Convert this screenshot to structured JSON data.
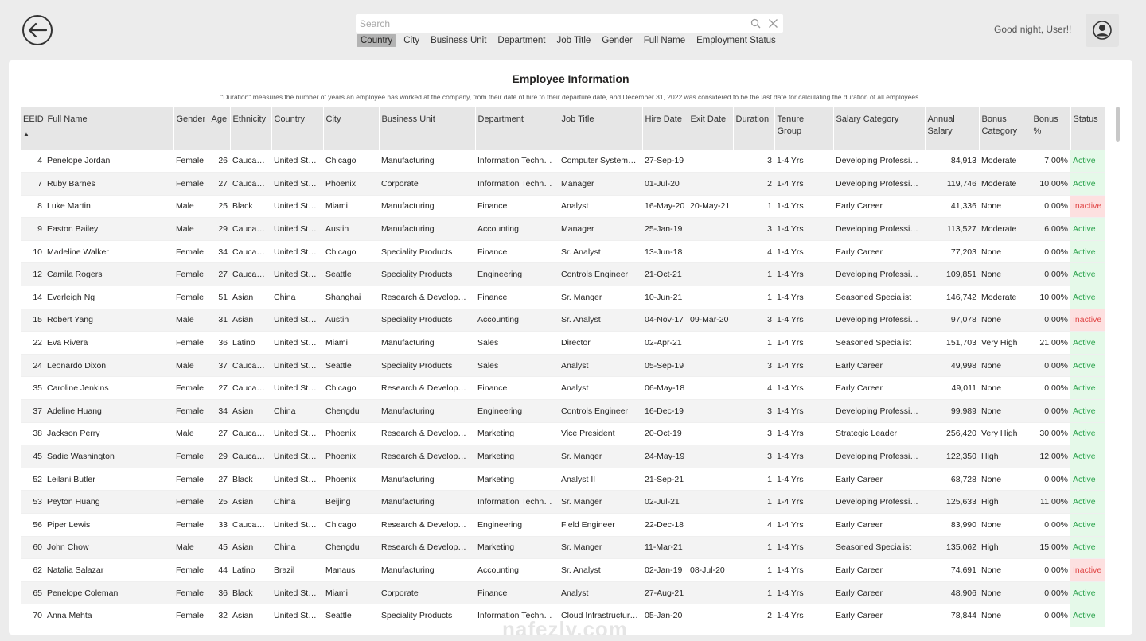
{
  "header": {
    "search_placeholder": "Search",
    "filters": [
      "Country",
      "City",
      "Business Unit",
      "Department",
      "Job Title",
      "Gender",
      "Full Name",
      "Employment Status"
    ],
    "active_filter": "Country",
    "greeting": "Good night, User!!"
  },
  "card": {
    "title": "Employee Information",
    "note": "\"Duration\" measures the number of years an employee has worked at the company, from their date of hire to their departure date, and December 31, 2022 was considered to be the last date for calculating the duration of all employees."
  },
  "table": {
    "columns": [
      "EEID",
      "Full Name",
      "Gender",
      "Age",
      "Ethnicity",
      "Country",
      "City",
      "Business Unit",
      "Department",
      "Job Title",
      "Hire Date",
      "Exit Date",
      "Duration",
      "Tenure Group",
      "Salary Category",
      "Annual Salary",
      "Bonus Category",
      "Bonus %",
      "Status"
    ],
    "sort_indicator": "▲",
    "rows": [
      [
        "4",
        "Penelope Jordan",
        "Female",
        "26",
        "Caucasian",
        "United Stat...",
        "Chicago",
        "Manufacturing",
        "Information Technol...",
        "Computer Systems ...",
        "27-Sep-19",
        "",
        "3",
        "1-4 Yrs",
        "Developing Professional",
        "84,913",
        "Moderate",
        "7.00%",
        "Active"
      ],
      [
        "7",
        "Ruby Barnes",
        "Female",
        "27",
        "Caucasian",
        "United Stat...",
        "Phoenix",
        "Corporate",
        "Information Technol...",
        "Manager",
        "01-Jul-20",
        "",
        "2",
        "1-4 Yrs",
        "Developing Professional",
        "119,746",
        "Moderate",
        "10.00%",
        "Active"
      ],
      [
        "8",
        "Luke Martin",
        "Male",
        "25",
        "Black",
        "United Stat...",
        "Miami",
        "Manufacturing",
        "Finance",
        "Analyst",
        "16-May-20",
        "20-May-21",
        "1",
        "1-4 Yrs",
        "Early Career",
        "41,336",
        "None",
        "0.00%",
        "Inactive"
      ],
      [
        "9",
        "Easton Bailey",
        "Male",
        "29",
        "Caucasian",
        "United Stat...",
        "Austin",
        "Manufacturing",
        "Accounting",
        "Manager",
        "25-Jan-19",
        "",
        "3",
        "1-4 Yrs",
        "Developing Professional",
        "113,527",
        "Moderate",
        "6.00%",
        "Active"
      ],
      [
        "10",
        "Madeline Walker",
        "Female",
        "34",
        "Caucasian",
        "United Stat...",
        "Chicago",
        "Speciality Products",
        "Finance",
        "Sr. Analyst",
        "13-Jun-18",
        "",
        "4",
        "1-4 Yrs",
        "Early Career",
        "77,203",
        "None",
        "0.00%",
        "Active"
      ],
      [
        "12",
        "Camila Rogers",
        "Female",
        "27",
        "Caucasian",
        "United Stat...",
        "Seattle",
        "Speciality Products",
        "Engineering",
        "Controls Engineer",
        "21-Oct-21",
        "",
        "1",
        "1-4 Yrs",
        "Developing Professional",
        "109,851",
        "None",
        "0.00%",
        "Active"
      ],
      [
        "14",
        "Everleigh Ng",
        "Female",
        "51",
        "Asian",
        "China",
        "Shanghai",
        "Research & Development",
        "Finance",
        "Sr. Manger",
        "10-Jun-21",
        "",
        "1",
        "1-4 Yrs",
        "Seasoned Specialist",
        "146,742",
        "Moderate",
        "10.00%",
        "Active"
      ],
      [
        "15",
        "Robert Yang",
        "Male",
        "31",
        "Asian",
        "United Stat...",
        "Austin",
        "Speciality Products",
        "Accounting",
        "Sr. Analyst",
        "04-Nov-17",
        "09-Mar-20",
        "3",
        "1-4 Yrs",
        "Developing Professional",
        "97,078",
        "None",
        "0.00%",
        "Inactive"
      ],
      [
        "22",
        "Eva Rivera",
        "Female",
        "36",
        "Latino",
        "United Stat...",
        "Miami",
        "Manufacturing",
        "Sales",
        "Director",
        "02-Apr-21",
        "",
        "1",
        "1-4 Yrs",
        "Seasoned Specialist",
        "151,703",
        "Very High",
        "21.00%",
        "Active"
      ],
      [
        "24",
        "Leonardo Dixon",
        "Male",
        "37",
        "Caucasian",
        "United Stat...",
        "Seattle",
        "Speciality Products",
        "Sales",
        "Analyst",
        "05-Sep-19",
        "",
        "3",
        "1-4 Yrs",
        "Early Career",
        "49,998",
        "None",
        "0.00%",
        "Active"
      ],
      [
        "35",
        "Caroline Jenkins",
        "Female",
        "27",
        "Caucasian",
        "United Stat...",
        "Chicago",
        "Research & Development",
        "Finance",
        "Analyst",
        "06-May-18",
        "",
        "4",
        "1-4 Yrs",
        "Early Career",
        "49,011",
        "None",
        "0.00%",
        "Active"
      ],
      [
        "37",
        "Adeline Huang",
        "Female",
        "34",
        "Asian",
        "China",
        "Chengdu",
        "Manufacturing",
        "Engineering",
        "Controls Engineer",
        "16-Dec-19",
        "",
        "3",
        "1-4 Yrs",
        "Developing Professional",
        "99,989",
        "None",
        "0.00%",
        "Active"
      ],
      [
        "38",
        "Jackson Perry",
        "Male",
        "27",
        "Caucasian",
        "United Stat...",
        "Phoenix",
        "Research & Development",
        "Marketing",
        "Vice President",
        "20-Oct-19",
        "",
        "3",
        "1-4 Yrs",
        "Strategic Leader",
        "256,420",
        "Very High",
        "30.00%",
        "Active"
      ],
      [
        "45",
        "Sadie Washington",
        "Female",
        "29",
        "Caucasian",
        "United Stat...",
        "Phoenix",
        "Research & Development",
        "Marketing",
        "Sr. Manger",
        "24-May-19",
        "",
        "3",
        "1-4 Yrs",
        "Developing Professional",
        "122,350",
        "High",
        "12.00%",
        "Active"
      ],
      [
        "52",
        "Leilani Butler",
        "Female",
        "27",
        "Black",
        "United Stat...",
        "Phoenix",
        "Manufacturing",
        "Marketing",
        "Analyst II",
        "21-Sep-21",
        "",
        "1",
        "1-4 Yrs",
        "Early Career",
        "68,728",
        "None",
        "0.00%",
        "Active"
      ],
      [
        "53",
        "Peyton Huang",
        "Female",
        "25",
        "Asian",
        "China",
        "Beijing",
        "Manufacturing",
        "Information Technol...",
        "Sr. Manger",
        "02-Jul-21",
        "",
        "1",
        "1-4 Yrs",
        "Developing Professional",
        "125,633",
        "High",
        "11.00%",
        "Active"
      ],
      [
        "56",
        "Piper Lewis",
        "Female",
        "33",
        "Caucasian",
        "United Stat...",
        "Chicago",
        "Research & Development",
        "Engineering",
        "Field Engineer",
        "22-Dec-18",
        "",
        "4",
        "1-4 Yrs",
        "Early Career",
        "83,990",
        "None",
        "0.00%",
        "Active"
      ],
      [
        "60",
        "John Chow",
        "Male",
        "45",
        "Asian",
        "China",
        "Chengdu",
        "Research & Development",
        "Marketing",
        "Sr. Manger",
        "11-Mar-21",
        "",
        "1",
        "1-4 Yrs",
        "Seasoned Specialist",
        "135,062",
        "High",
        "15.00%",
        "Active"
      ],
      [
        "62",
        "Natalia Salazar",
        "Female",
        "44",
        "Latino",
        "Brazil",
        "Manaus",
        "Manufacturing",
        "Accounting",
        "Sr. Analyst",
        "02-Jan-19",
        "08-Jul-20",
        "1",
        "1-4 Yrs",
        "Early Career",
        "74,691",
        "None",
        "0.00%",
        "Inactive"
      ],
      [
        "65",
        "Penelope Coleman",
        "Female",
        "36",
        "Black",
        "United Stat...",
        "Miami",
        "Corporate",
        "Finance",
        "Analyst",
        "27-Aug-21",
        "",
        "1",
        "1-4 Yrs",
        "Early Career",
        "48,906",
        "None",
        "0.00%",
        "Active"
      ],
      [
        "70",
        "Anna Mehta",
        "Female",
        "32",
        "Asian",
        "United Stat...",
        "Seattle",
        "Speciality Products",
        "Information Technol...",
        "Cloud Infrastructure...",
        "05-Jan-20",
        "",
        "2",
        "1-4 Yrs",
        "Early Career",
        "78,844",
        "None",
        "0.00%",
        "Active"
      ]
    ]
  },
  "watermark": "nafezly.com",
  "colors": {
    "active_bg": "#e5f9e9",
    "active_text": "#2ea44f",
    "inactive_bg": "#fde0e0",
    "inactive_text": "#e04545"
  }
}
